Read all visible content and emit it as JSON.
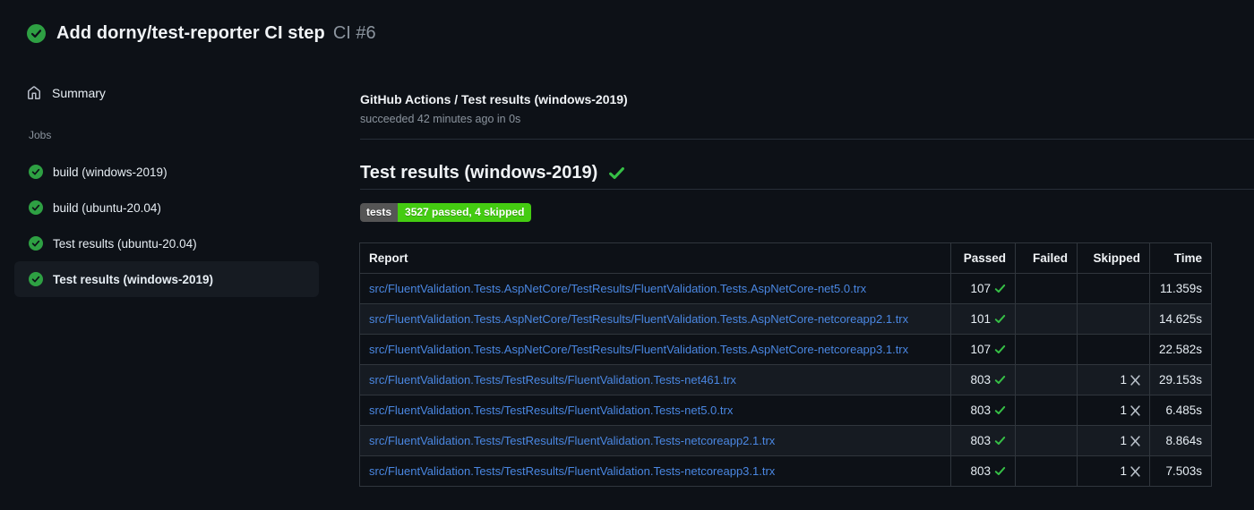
{
  "header": {
    "title": "Add dorny/test-reporter CI step",
    "run_number": "CI #6"
  },
  "sidebar": {
    "summary_label": "Summary",
    "jobs_label": "Jobs",
    "jobs": [
      {
        "label": "build (windows-2019)",
        "selected": false
      },
      {
        "label": "build (ubuntu-20.04)",
        "selected": false
      },
      {
        "label": "Test results (ubuntu-20.04)",
        "selected": false
      },
      {
        "label": "Test results (windows-2019)",
        "selected": true
      }
    ]
  },
  "job_header": {
    "title": "GitHub Actions / Test results (windows-2019)",
    "status_line": "succeeded 42 minutes ago in 0s"
  },
  "report": {
    "heading": "Test results (windows-2019)",
    "badge": {
      "label": "tests",
      "value": "3527 passed, 4 skipped"
    },
    "table": {
      "columns": [
        "Report",
        "Passed",
        "Failed",
        "Skipped",
        "Time"
      ],
      "rows": [
        {
          "report": "src/FluentValidation.Tests.AspNetCore/TestResults/FluentValidation.Tests.AspNetCore-net5.0.trx",
          "passed": "107",
          "failed": "",
          "skipped": "",
          "time": "11.359s"
        },
        {
          "report": "src/FluentValidation.Tests.AspNetCore/TestResults/FluentValidation.Tests.AspNetCore-netcoreapp2.1.trx",
          "passed": "101",
          "failed": "",
          "skipped": "",
          "time": "14.625s"
        },
        {
          "report": "src/FluentValidation.Tests.AspNetCore/TestResults/FluentValidation.Tests.AspNetCore-netcoreapp3.1.trx",
          "passed": "107",
          "failed": "",
          "skipped": "",
          "time": "22.582s"
        },
        {
          "report": "src/FluentValidation.Tests/TestResults/FluentValidation.Tests-net461.trx",
          "passed": "803",
          "failed": "",
          "skipped": "1",
          "time": "29.153s"
        },
        {
          "report": "src/FluentValidation.Tests/TestResults/FluentValidation.Tests-net5.0.trx",
          "passed": "803",
          "failed": "",
          "skipped": "1",
          "time": "6.485s"
        },
        {
          "report": "src/FluentValidation.Tests/TestResults/FluentValidation.Tests-netcoreapp2.1.trx",
          "passed": "803",
          "failed": "",
          "skipped": "1",
          "time": "8.864s"
        },
        {
          "report": "src/FluentValidation.Tests/TestResults/FluentValidation.Tests-netcoreapp3.1.trx",
          "passed": "803",
          "failed": "",
          "skipped": "1",
          "time": "7.503s"
        }
      ]
    }
  },
  "icons": {
    "run_status": "check-circle",
    "job_status": "check-circle",
    "summary": "home",
    "passed_mark": "check",
    "skipped_mark": "cross"
  },
  "colors": {
    "background": "#0d1117",
    "row_alt": "#161b22",
    "border": "#30363d",
    "muted_text": "#8b949e",
    "success_circle": "#2ea043",
    "success_check": "#36c046",
    "link": "#4a87e2",
    "badge_label_bg": "#555555",
    "badge_value_bg": "#44cc11"
  }
}
